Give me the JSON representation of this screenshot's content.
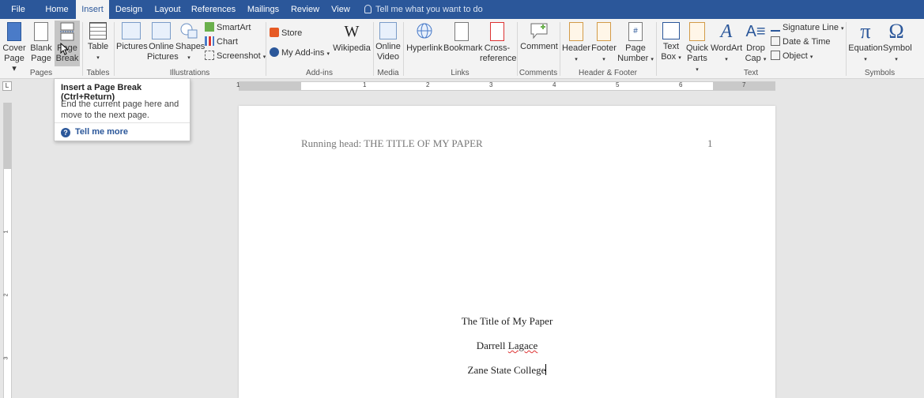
{
  "tabs": [
    {
      "label": "File"
    },
    {
      "label": "Home"
    },
    {
      "label": "Insert"
    },
    {
      "label": "Design"
    },
    {
      "label": "Layout"
    },
    {
      "label": "References"
    },
    {
      "label": "Mailings"
    },
    {
      "label": "Review"
    },
    {
      "label": "View"
    }
  ],
  "tell_me": "Tell me what you want to do",
  "ribbon": {
    "cover_page": [
      "Cover",
      "Page ▾"
    ],
    "blank_page": [
      "Blank",
      "Page"
    ],
    "page_break": [
      "Page",
      "Break"
    ],
    "table": "Table",
    "pictures": "Pictures",
    "online_pictures": [
      "Online",
      "Pictures"
    ],
    "shapes": "Shapes",
    "smartart": "SmartArt",
    "chart": "Chart",
    "screenshot": "Screenshot",
    "store": "Store",
    "my_addins": "My Add-ins",
    "wikipedia": "Wikipedia",
    "online_video": [
      "Online",
      "Video"
    ],
    "hyperlink": "Hyperlink",
    "bookmark": "Bookmark",
    "cross_reference": [
      "Cross-",
      "reference"
    ],
    "comment": "Comment",
    "header": "Header",
    "footer": "Footer",
    "page_number": [
      "Page",
      "Number"
    ],
    "text_box": [
      "Text",
      "Box"
    ],
    "quick_parts": [
      "Quick",
      "Parts"
    ],
    "wordart": "WordArt",
    "drop_cap": [
      "Drop",
      "Cap"
    ],
    "signature_line": "Signature Line",
    "date_time": "Date & Time",
    "object": "Object",
    "equation": "Equation",
    "symbol": "Symbol",
    "groups": {
      "pages": "Pages",
      "tables": "Tables",
      "illustrations": "Illustrations",
      "addins": "Add-ins",
      "media": "Media",
      "links": "Links",
      "comments": "Comments",
      "header_footer": "Header & Footer",
      "text": "Text",
      "symbols": "Symbols"
    }
  },
  "tooltip": {
    "title": "Insert a Page Break (Ctrl+Return)",
    "desc": "End the current page here and move to the next page.",
    "more": "Tell me more"
  },
  "ruler_numbers": [
    "1",
    "1",
    "2",
    "3",
    "4",
    "5",
    "6",
    "7"
  ],
  "vruler_numbers": [
    "1",
    "1",
    "2",
    "3"
  ],
  "document": {
    "running_head": "Running head: THE TITLE OF MY PAPER",
    "page_number": "1",
    "title": "The Title of My Paper",
    "author_first": "Darrell ",
    "author_last": "Lagace",
    "institution": "Zane State College"
  },
  "colors": {
    "accent": "#2b579a",
    "ribbon": "#f3f3f3",
    "page": "#ffffff"
  }
}
